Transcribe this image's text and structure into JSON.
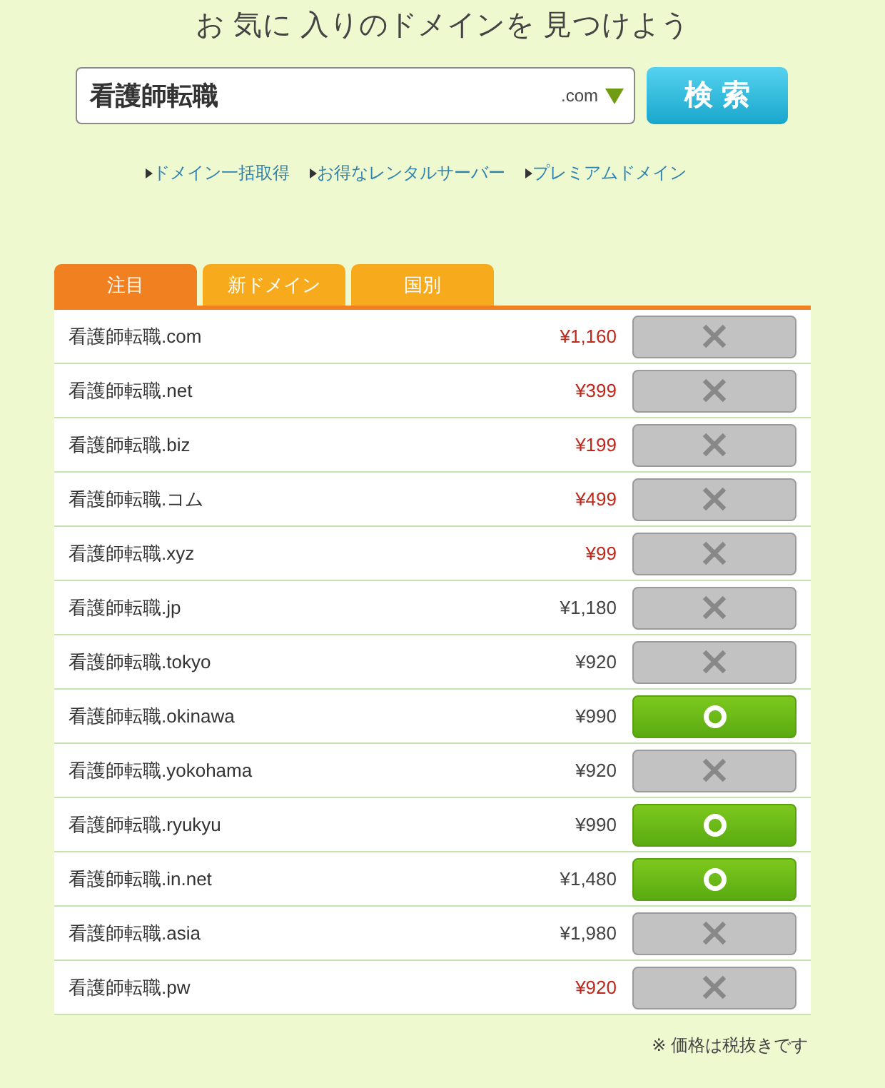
{
  "title": "お 気に 入りのドメインを 見つけよう",
  "search": {
    "value": "看護師転職",
    "tld": ".com",
    "button": "検 索"
  },
  "links": [
    "ドメイン一括取得",
    "お得なレンタルサーバー",
    "プレミアムドメイン"
  ],
  "tabs": [
    {
      "label": "注目",
      "selected": true
    },
    {
      "label": "新ドメイン",
      "selected": false
    },
    {
      "label": "国別",
      "selected": false
    }
  ],
  "results": [
    {
      "domain": "看護師転職.com",
      "price": "¥1,160",
      "discounted": true,
      "available": false
    },
    {
      "domain": "看護師転職.net",
      "price": "¥399",
      "discounted": true,
      "available": false
    },
    {
      "domain": "看護師転職.biz",
      "price": "¥199",
      "discounted": true,
      "available": false
    },
    {
      "domain": "看護師転職.コム",
      "price": "¥499",
      "discounted": true,
      "available": false
    },
    {
      "domain": "看護師転職.xyz",
      "price": "¥99",
      "discounted": true,
      "available": false
    },
    {
      "domain": "看護師転職.jp",
      "price": "¥1,180",
      "discounted": false,
      "available": false
    },
    {
      "domain": "看護師転職.tokyo",
      "price": "¥920",
      "discounted": false,
      "available": false
    },
    {
      "domain": "看護師転職.okinawa",
      "price": "¥990",
      "discounted": false,
      "available": true
    },
    {
      "domain": "看護師転職.yokohama",
      "price": "¥920",
      "discounted": false,
      "available": false
    },
    {
      "domain": "看護師転職.ryukyu",
      "price": "¥990",
      "discounted": false,
      "available": true
    },
    {
      "domain": "看護師転職.in.net",
      "price": "¥1,480",
      "discounted": false,
      "available": true
    },
    {
      "domain": "看護師転職.asia",
      "price": "¥1,980",
      "discounted": false,
      "available": false
    },
    {
      "domain": "看護師転職.pw",
      "price": "¥920",
      "discounted": true,
      "available": false
    }
  ],
  "note": "※ 価格は税抜きです"
}
